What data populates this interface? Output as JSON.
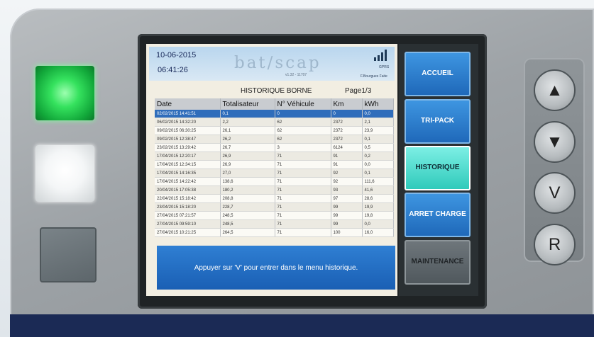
{
  "status": {
    "date": "10-06-2015",
    "time": "06:41:26",
    "network": "GPRS",
    "user": "F.Bourgues Faite"
  },
  "logo": {
    "text": "bat/scap",
    "version": "v1.32 - 11707"
  },
  "screen": {
    "title": "HISTORIQUE BORNE",
    "page": "Page1/3"
  },
  "table": {
    "headers": [
      "Date",
      "Totalisateur",
      "N° Véhicule",
      "Km",
      "kWh"
    ],
    "rows": [
      [
        "02/02/2015 14:41:51",
        "0,1",
        "0",
        "0",
        "0,0"
      ],
      [
        "06/02/2015 14:32:20",
        "2,2",
        "62",
        "2372",
        "2,1"
      ],
      [
        "09/02/2015 06:30:25",
        "26,1",
        "62",
        "2372",
        "23,9"
      ],
      [
        "09/02/2015 12:38:47",
        "26,2",
        "62",
        "2372",
        "0,1"
      ],
      [
        "23/02/2015 13:29:42",
        "26,7",
        "3",
        "6124",
        "0,5"
      ],
      [
        "17/04/2015 12:20:17",
        "26,9",
        "71",
        "91",
        "0,2"
      ],
      [
        "17/04/2015 12:34:15",
        "26,9",
        "71",
        "91",
        "0,0"
      ],
      [
        "17/04/2015 14:16:35",
        "27,0",
        "71",
        "92",
        "0,1"
      ],
      [
        "17/04/2015 14:22:42",
        "138,6",
        "71",
        "92",
        "111,6"
      ],
      [
        "20/04/2015 17:05:38",
        "180,2",
        "71",
        "93",
        "41,6"
      ],
      [
        "22/04/2015 15:18:42",
        "208,8",
        "71",
        "97",
        "28,6"
      ],
      [
        "23/04/2015 15:18:20",
        "228,7",
        "71",
        "99",
        "19,9"
      ],
      [
        "27/04/2015 07:21:57",
        "248,5",
        "71",
        "99",
        "19,8"
      ],
      [
        "27/04/2015 09:59:10",
        "248,5",
        "71",
        "99",
        "0,0"
      ],
      [
        "27/04/2015 10:21:25",
        "264,5",
        "71",
        "100",
        "16,0"
      ]
    ],
    "selected_row": 0
  },
  "message": "Appuyer sur 'V' pour entrer dans le menu historique.",
  "menu": {
    "accueil": "ACCUEIL",
    "tripack": "TRI-PACK",
    "historique": "HISTORIQUE",
    "arret": "ARRET CHARGE",
    "maintenance": "MAINTENANCE"
  },
  "keys": {
    "up": "▲",
    "down": "▼",
    "validate": "V",
    "reset": "R"
  },
  "colors": {
    "led_green": "#35e25e",
    "accent_blue": "#1e67b8",
    "active_teal": "#2dc9b9"
  }
}
